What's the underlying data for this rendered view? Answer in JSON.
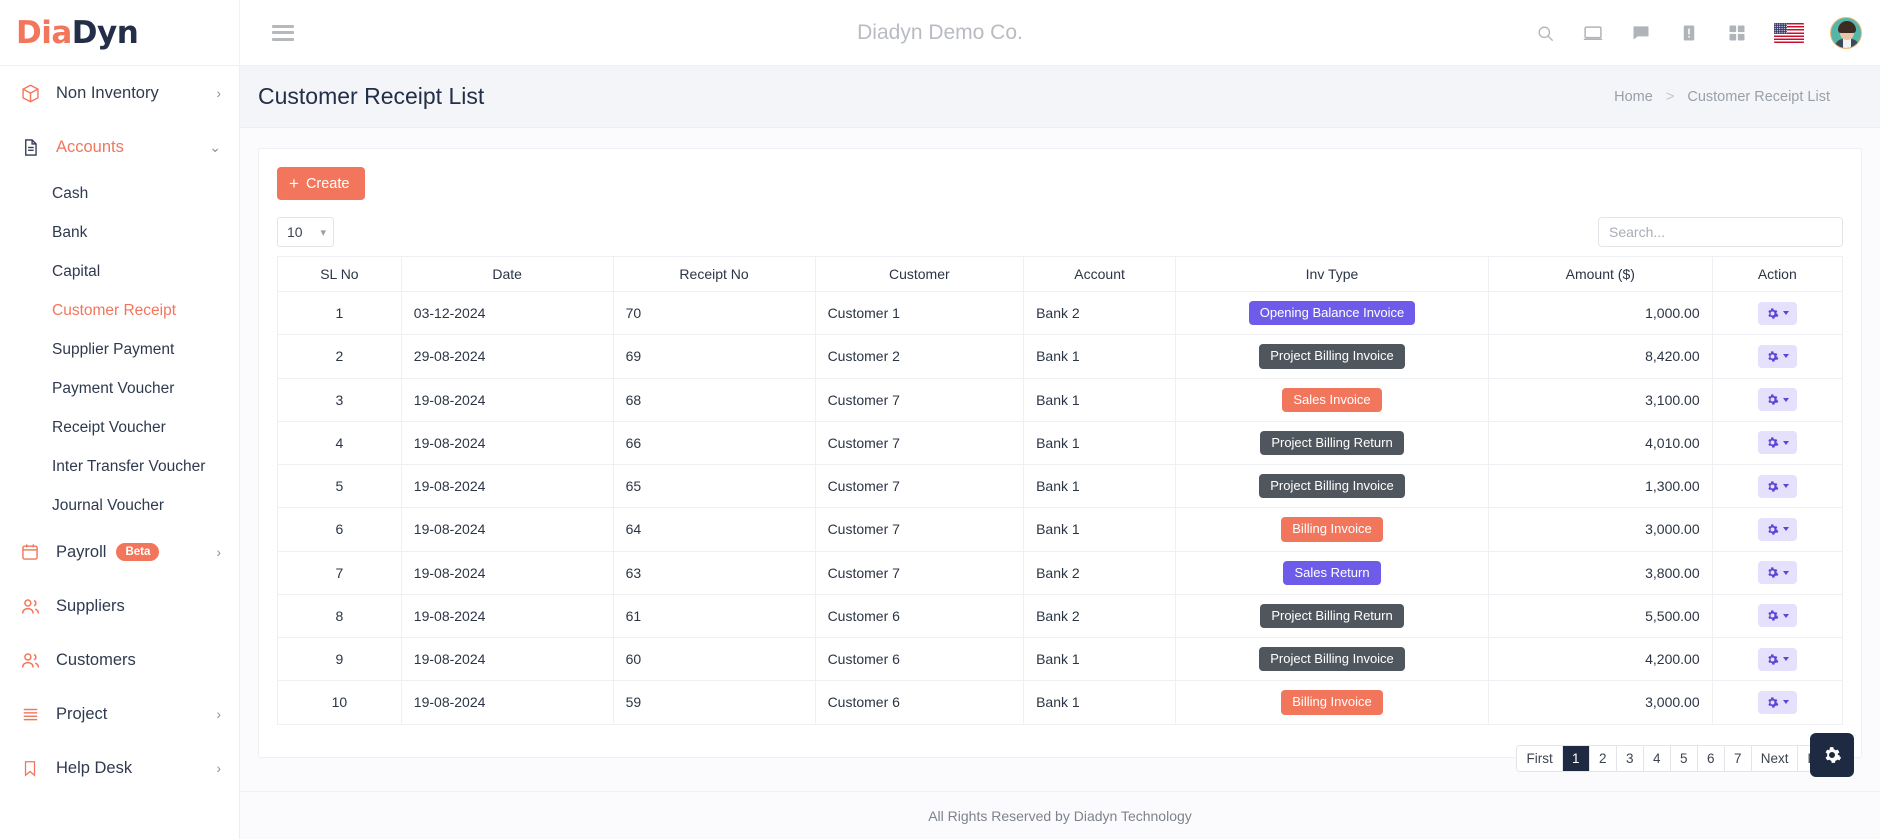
{
  "brand": {
    "logo_part1": "Dia",
    "logo_part2": "Dyn"
  },
  "topbar": {
    "company_title": "Diadyn Demo Co.",
    "icons": [
      "search-icon",
      "monitor-icon",
      "chat-icon",
      "alert-icon",
      "grid-icon",
      "flag-icon",
      "avatar"
    ]
  },
  "sidebar": {
    "items": [
      {
        "label": "Non Inventory",
        "icon": "box-icon",
        "active": false,
        "expandable": true
      },
      {
        "label": "Accounts",
        "icon": "document-icon",
        "active": true,
        "expandable": true
      },
      {
        "label": "Payroll",
        "icon": "calendar-icon",
        "active": false,
        "expandable": true,
        "badge": "Beta"
      },
      {
        "label": "Suppliers",
        "icon": "users-icon",
        "active": false,
        "expandable": false
      },
      {
        "label": "Customers",
        "icon": "users-icon",
        "active": false,
        "expandable": false
      },
      {
        "label": "Project",
        "icon": "list-icon",
        "active": false,
        "expandable": true
      },
      {
        "label": "Help Desk",
        "icon": "bookmark-icon",
        "active": false,
        "expandable": true
      }
    ],
    "accounts_sub": [
      {
        "label": "Cash",
        "active": false
      },
      {
        "label": "Bank",
        "active": false
      },
      {
        "label": "Capital",
        "active": false
      },
      {
        "label": "Customer Receipt",
        "active": true
      },
      {
        "label": "Supplier Payment",
        "active": false
      },
      {
        "label": "Payment Voucher",
        "active": false
      },
      {
        "label": "Receipt Voucher",
        "active": false
      },
      {
        "label": "Inter Transfer Voucher",
        "active": false
      },
      {
        "label": "Journal Voucher",
        "active": false
      }
    ]
  },
  "page": {
    "title": "Customer Receipt List",
    "breadcrumb_home": "Home",
    "breadcrumb_sep": ">",
    "breadcrumb_current": "Customer Receipt List"
  },
  "toolbar": {
    "create_label": "Create",
    "create_icon": "plus-icon",
    "page_length": "10",
    "search_placeholder": "Search...",
    "search_value": ""
  },
  "table": {
    "columns": [
      "SL No",
      "Date",
      "Receipt No",
      "Customer",
      "Account",
      "Inv Type",
      "Amount ($)",
      "Action"
    ],
    "rows": [
      {
        "sl": "1",
        "date": "03-12-2024",
        "receipt": "70",
        "customer": "Customer 1",
        "account": "Bank 2",
        "inv_type": "Opening Balance Invoice",
        "inv_color": "purple",
        "amount": "1,000.00"
      },
      {
        "sl": "2",
        "date": "29-08-2024",
        "receipt": "69",
        "customer": "Customer 2",
        "account": "Bank 1",
        "inv_type": "Project Billing Invoice",
        "inv_color": "gray",
        "amount": "8,420.00"
      },
      {
        "sl": "3",
        "date": "19-08-2024",
        "receipt": "68",
        "customer": "Customer 7",
        "account": "Bank 1",
        "inv_type": "Sales Invoice",
        "inv_color": "orange",
        "amount": "3,100.00"
      },
      {
        "sl": "4",
        "date": "19-08-2024",
        "receipt": "66",
        "customer": "Customer 7",
        "account": "Bank 1",
        "inv_type": "Project Billing Return",
        "inv_color": "gray",
        "amount": "4,010.00"
      },
      {
        "sl": "5",
        "date": "19-08-2024",
        "receipt": "65",
        "customer": "Customer 7",
        "account": "Bank 1",
        "inv_type": "Project Billing Invoice",
        "inv_color": "gray",
        "amount": "1,300.00"
      },
      {
        "sl": "6",
        "date": "19-08-2024",
        "receipt": "64",
        "customer": "Customer 7",
        "account": "Bank 1",
        "inv_type": "Billing Invoice",
        "inv_color": "orange",
        "amount": "3,000.00"
      },
      {
        "sl": "7",
        "date": "19-08-2024",
        "receipt": "63",
        "customer": "Customer 7",
        "account": "Bank 2",
        "inv_type": "Sales Return",
        "inv_color": "purple",
        "amount": "3,800.00"
      },
      {
        "sl": "8",
        "date": "19-08-2024",
        "receipt": "61",
        "customer": "Customer 6",
        "account": "Bank 2",
        "inv_type": "Project Billing Return",
        "inv_color": "gray",
        "amount": "5,500.00"
      },
      {
        "sl": "9",
        "date": "19-08-2024",
        "receipt": "60",
        "customer": "Customer 6",
        "account": "Bank 1",
        "inv_type": "Project Billing Invoice",
        "inv_color": "gray",
        "amount": "4,200.00"
      },
      {
        "sl": "10",
        "date": "19-08-2024",
        "receipt": "59",
        "customer": "Customer 6",
        "account": "Bank 1",
        "inv_type": "Billing Invoice",
        "inv_color": "orange",
        "amount": "3,000.00"
      }
    ],
    "action_icon": "gear-icon"
  },
  "pagination": {
    "buttons": [
      "First",
      "1",
      "2",
      "3",
      "4",
      "5",
      "6",
      "7",
      "Next",
      "Last"
    ],
    "active": "1"
  },
  "footer": {
    "text": "All Rights Reserved by Diadyn Technology"
  },
  "fab": {
    "icon": "gear-icon"
  },
  "colors": {
    "accent": "#f2765c",
    "dark": "#232f48",
    "purple_badge": "#6f5bea",
    "gray_badge": "#4f565d",
    "action_bg": "#e5e0fb",
    "action_fg": "#5b45d6"
  }
}
